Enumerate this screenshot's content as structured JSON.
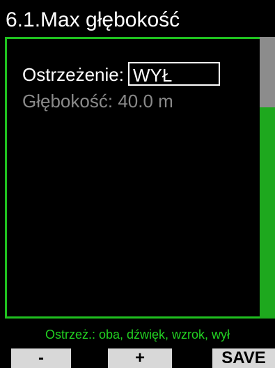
{
  "header": {
    "title": "6.1.Max głębokość"
  },
  "settings": {
    "warning_label": "Ostrzeżenie:",
    "warning_value": "WYŁ",
    "depth_label": "Głębokość:",
    "depth_value": "40.0 m"
  },
  "scrollbar": {
    "position_fraction": 0.0,
    "visible_fraction": 0.25
  },
  "hint": {
    "text": "Ostrzeż.: oba, dźwięk, wzrok, wył"
  },
  "softkeys": {
    "left_label": "-",
    "center_label": "+",
    "right_label": "SAVE"
  },
  "colors": {
    "accent_green": "#1fc01f",
    "hint_green": "#22d022",
    "disabled_gray": "#8a8a8a",
    "softkey_gray": "#d8d8d8"
  }
}
